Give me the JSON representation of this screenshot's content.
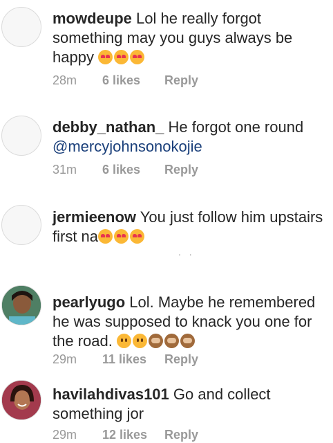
{
  "comments": [
    {
      "username": "mowdeupe",
      "text": "Lol he really forgot something may you guys always be happy",
      "emojis": [
        "heart-eyes",
        "heart-eyes",
        "heart-eyes"
      ],
      "time": "28m",
      "likes": "6 likes",
      "reply": "Reply"
    },
    {
      "username": "debby_nathan_",
      "text": "He forgot one round",
      "mention": "@mercyjohnsonokojie",
      "time": "31m",
      "likes": "6 likes",
      "reply": "Reply"
    },
    {
      "username": "jermieenow",
      "text": "You just follow him upstairs first na",
      "emojis": [
        "heart-eyes",
        "heart-eyes",
        "heart-eyes"
      ]
    },
    {
      "username": "pearlyugo",
      "text": "Lol. Maybe he remembered he was supposed to knack you one for the road.",
      "emojis": [
        "grinning",
        "grinning",
        "see-no-evil-monkey",
        "see-no-evil-monkey",
        "see-no-evil-monkey"
      ],
      "time": "29m",
      "likes": "11 likes",
      "reply": "Reply"
    },
    {
      "username": "havilahdivas101",
      "text": "Go and collect something jor",
      "time": "29m",
      "likes": "12 likes",
      "reply": "Reply"
    }
  ],
  "colors": {
    "text": "#262626",
    "meta": "#999999",
    "mention": "#1a3f7a",
    "emoji": "#fbb836"
  }
}
